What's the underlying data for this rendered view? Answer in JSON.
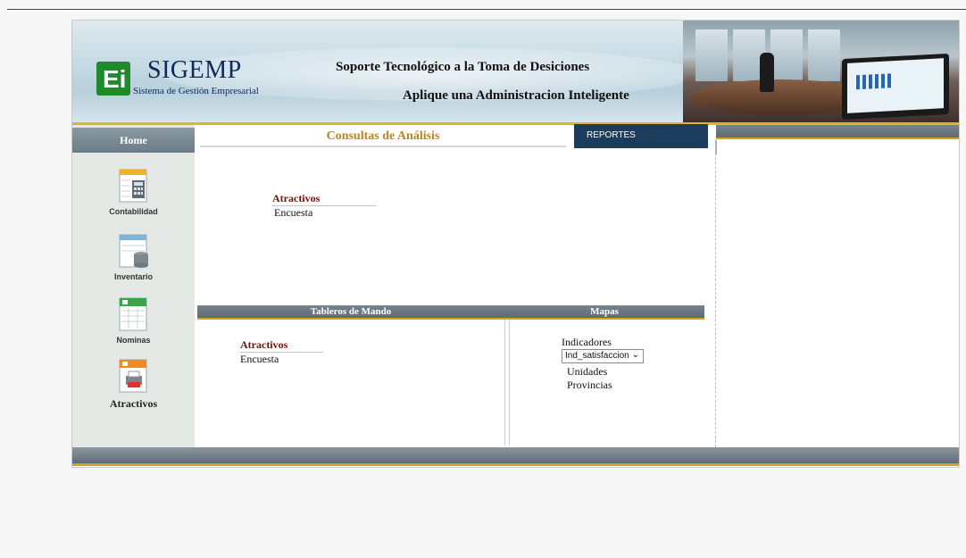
{
  "banner": {
    "logo_title": "SIGEMP",
    "logo_subtitle": "Sistema de Gestión Empresarial",
    "tagline_1": "Soporte Tecnológico a la Toma de Desiciones",
    "tagline_2": "Aplique una Administracion Inteligente"
  },
  "sidebar": {
    "home_label": "Home",
    "items": [
      {
        "label": "Contabilidad",
        "icon": "calculator-icon"
      },
      {
        "label": "Inventario",
        "icon": "database-icon"
      },
      {
        "label": "Nominas",
        "icon": "spreadsheet-icon"
      },
      {
        "label": "Atractivos",
        "icon": "printer-icon"
      }
    ]
  },
  "main": {
    "title": "Consultas de Análisis",
    "reportes_label": "REPORTES",
    "consultas": {
      "group_title": "Atractivos",
      "item": "Encuesta"
    },
    "tableros": {
      "header": "Tableros de Mando",
      "group_title": "Atractivos",
      "item": "Encuesta"
    },
    "mapas": {
      "header": "Mapas",
      "indicadores_label": "Indicadores",
      "select_value": "Ind_satisfaccion",
      "items": [
        "Unidades",
        "Provincias"
      ]
    }
  },
  "colors": {
    "accent_gold": "#d9a21b",
    "title_gold": "#b7871e",
    "link_red": "#7a0c0c",
    "navy": "#1c3c5b"
  }
}
